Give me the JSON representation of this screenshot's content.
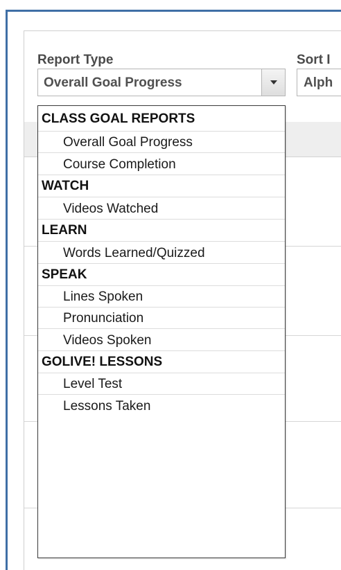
{
  "filters": {
    "report_type_label": "Report Type",
    "report_type_value": "Overall Goal Progress",
    "sort_label": "Sort I",
    "sort_value": "Alph"
  },
  "dropdown": {
    "groups": [
      {
        "label": "CLASS GOAL REPORTS",
        "options": [
          "Overall Goal Progress",
          "Course Completion"
        ]
      },
      {
        "label": "WATCH",
        "options": [
          "Videos Watched"
        ]
      },
      {
        "label": "LEARN",
        "options": [
          "Words Learned/Quizzed"
        ]
      },
      {
        "label": "SPEAK",
        "options": [
          "Lines Spoken",
          "Pronunciation",
          "Videos Spoken"
        ]
      },
      {
        "label": "GOLIVE! LESSONS",
        "options": [
          "Level Test",
          "Lessons Taken"
        ]
      }
    ]
  },
  "colors": {
    "frame_border": "#3f6fa6",
    "header_bg": "#eeeeee"
  }
}
